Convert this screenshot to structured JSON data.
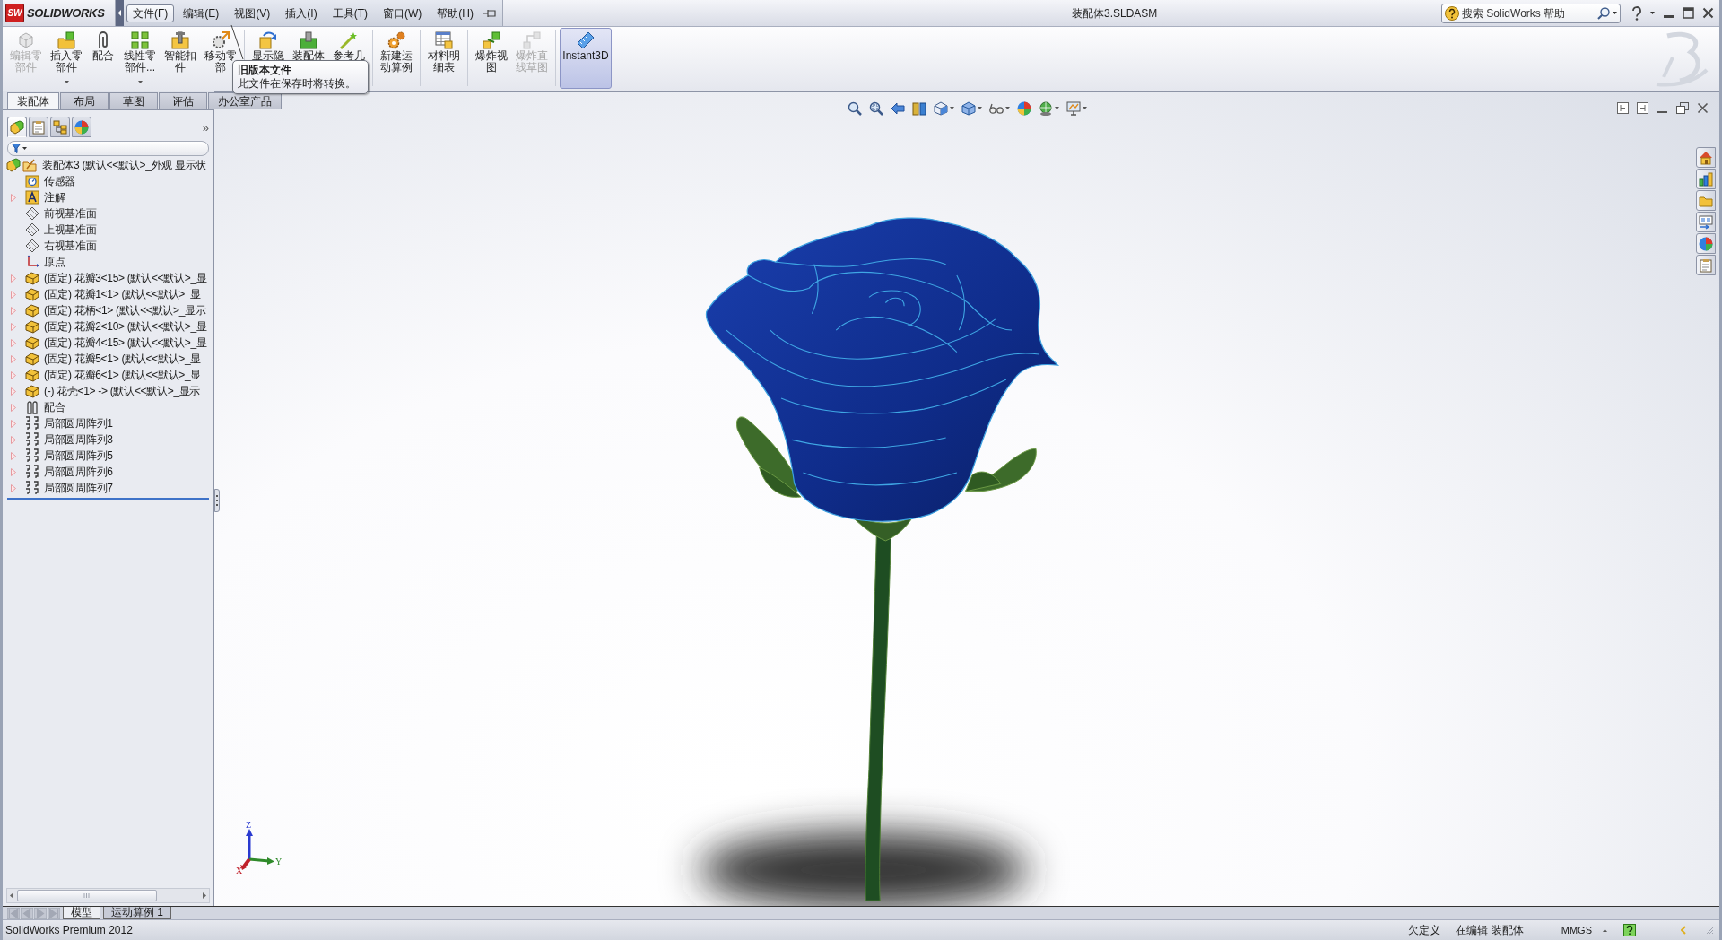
{
  "title_bar": {
    "logo_badge": "SW",
    "logo_text": "SOLIDWORKS",
    "title": "装配体3.SLDASM",
    "search": {
      "placeholder": "搜索 SolidWorks 帮助"
    }
  },
  "menu": [
    {
      "label": "文件(F)",
      "selected": true
    },
    {
      "label": "编辑(E)",
      "selected": false
    },
    {
      "label": "视图(V)",
      "selected": false
    },
    {
      "label": "插入(I)",
      "selected": false
    },
    {
      "label": "工具(T)",
      "selected": false
    },
    {
      "label": "窗口(W)",
      "selected": false
    },
    {
      "label": "帮助(H)",
      "selected": false
    }
  ],
  "toolbar": {
    "groups": [
      [
        {
          "label": "编辑零部件",
          "kind": "edit-part",
          "disabled": true,
          "dropdown": false,
          "selected": false
        },
        {
          "label": "插入零部件",
          "kind": "insert",
          "disabled": false,
          "dropdown": true,
          "selected": false
        },
        {
          "label": "配合",
          "kind": "mate",
          "disabled": false,
          "dropdown": false,
          "selected": false
        },
        {
          "label": "线性零部件...",
          "kind": "pattern",
          "disabled": false,
          "dropdown": true,
          "selected": false
        },
        {
          "label": "智能扣件",
          "kind": "fastener",
          "disabled": false,
          "dropdown": false,
          "selected": false
        },
        {
          "label": "移动零部",
          "kind": "move",
          "disabled": false,
          "dropdown": false,
          "selected": false
        }
      ],
      [
        {
          "label": "显示隐",
          "kind": "show-hide",
          "disabled": false,
          "dropdown": false,
          "selected": false
        },
        {
          "label": "装配体",
          "kind": "features",
          "disabled": false,
          "dropdown": false,
          "selected": false
        },
        {
          "label": "参考几",
          "kind": "reference",
          "disabled": false,
          "dropdown": false,
          "selected": false
        }
      ],
      [
        {
          "label": "新建运动算例",
          "kind": "motion",
          "disabled": false,
          "dropdown": false,
          "selected": false
        }
      ],
      [
        {
          "label": "材料明细表",
          "kind": "bom",
          "disabled": false,
          "dropdown": false,
          "selected": false
        }
      ],
      [
        {
          "label": "爆炸视图",
          "kind": "explode",
          "disabled": false,
          "dropdown": false,
          "selected": false
        },
        {
          "label": "爆炸直线草图",
          "kind": "explode-line",
          "disabled": true,
          "dropdown": false,
          "selected": false
        }
      ],
      [
        {
          "label": "Instant3D",
          "kind": "instant3d",
          "disabled": false,
          "dropdown": false,
          "selected": true
        }
      ]
    ]
  },
  "tooltip": {
    "title": "旧版本文件",
    "text": "此文件在保存时将转换。"
  },
  "command_tabs": [
    {
      "label": "装配体",
      "selected": true
    },
    {
      "label": "布局",
      "selected": false
    },
    {
      "label": "草图",
      "selected": false
    },
    {
      "label": "评估",
      "selected": false
    },
    {
      "label": "办公室产品",
      "selected": false
    }
  ],
  "feature_manager": {
    "panel_tabs": [
      {
        "kind": "feature-tree",
        "selected": true
      },
      {
        "kind": "properties",
        "selected": false
      },
      {
        "kind": "configurations",
        "selected": false
      },
      {
        "kind": "display",
        "selected": false
      }
    ],
    "more": "»",
    "tree": {
      "label": "装配体3 (默认<<默认>_外观 显示状",
      "kind": "assembly",
      "children": [
        {
          "label": "传感器",
          "kind": "sensors",
          "expandable": false
        },
        {
          "label": "注解",
          "kind": "annotations",
          "expandable": true
        },
        {
          "label": "前视基准面",
          "kind": "plane",
          "expandable": false
        },
        {
          "label": "上视基准面",
          "kind": "plane",
          "expandable": false
        },
        {
          "label": "右视基准面",
          "kind": "plane",
          "expandable": false
        },
        {
          "label": "原点",
          "kind": "origin",
          "expandable": false
        },
        {
          "label": "(固定) 花瓣3<15> (默认<<默认>_显",
          "kind": "part",
          "expandable": true
        },
        {
          "label": "(固定) 花瓣1<1> (默认<<默认>_显",
          "kind": "part",
          "expandable": true
        },
        {
          "label": "(固定) 花柄<1> (默认<<默认>_显示",
          "kind": "part",
          "expandable": true
        },
        {
          "label": "(固定) 花瓣2<10> (默认<<默认>_显",
          "kind": "part",
          "expandable": true
        },
        {
          "label": "(固定) 花瓣4<15> (默认<<默认>_显",
          "kind": "part",
          "expandable": true
        },
        {
          "label": "(固定) 花瓣5<1> (默认<<默认>_显",
          "kind": "part",
          "expandable": true
        },
        {
          "label": "(固定) 花瓣6<1> (默认<<默认>_显",
          "kind": "part",
          "expandable": true
        },
        {
          "label": "(-) 花壳<1> -> (默认<<默认>_显示",
          "kind": "part",
          "expandable": true
        },
        {
          "label": "配合",
          "kind": "mates",
          "expandable": true
        },
        {
          "label": "局部圆周阵列1",
          "kind": "pattern",
          "expandable": true
        },
        {
          "label": "局部圆周阵列3",
          "kind": "pattern",
          "expandable": true
        },
        {
          "label": "局部圆周阵列5",
          "kind": "pattern",
          "expandable": true
        },
        {
          "label": "局部圆周阵列6",
          "kind": "pattern",
          "expandable": true
        },
        {
          "label": "局部圆周阵列7",
          "kind": "pattern",
          "expandable": true
        }
      ]
    }
  },
  "viewport": {
    "view_tools": [
      {
        "kind": "zoom-fit",
        "dropdown": false
      },
      {
        "kind": "zoom-area",
        "dropdown": false
      },
      {
        "kind": "previous",
        "dropdown": false
      },
      {
        "kind": "section",
        "dropdown": false
      },
      {
        "kind": "orientation",
        "dropdown": true
      },
      {
        "kind": "display-style",
        "dropdown": true
      },
      {
        "kind": "hide-show",
        "dropdown": true
      },
      {
        "kind": "appearance",
        "dropdown": false
      },
      {
        "kind": "scene",
        "dropdown": true
      },
      {
        "kind": "view-settings",
        "dropdown": true
      }
    ],
    "triad": {
      "x": "X",
      "y": "Y",
      "z": "Z"
    },
    "task_pane": [
      {
        "kind": "home"
      },
      {
        "kind": "library"
      },
      {
        "kind": "folder"
      },
      {
        "kind": "palette"
      },
      {
        "kind": "appearances"
      },
      {
        "kind": "properties"
      }
    ]
  },
  "bottom_tabs": [
    {
      "label": "模型",
      "selected": true
    },
    {
      "label": "运动算例 1",
      "selected": false
    }
  ],
  "status_bar": {
    "product": "SolidWorks Premium 2012",
    "state": "欠定义",
    "mode": "在编辑 装配体",
    "units": "MMGS"
  }
}
